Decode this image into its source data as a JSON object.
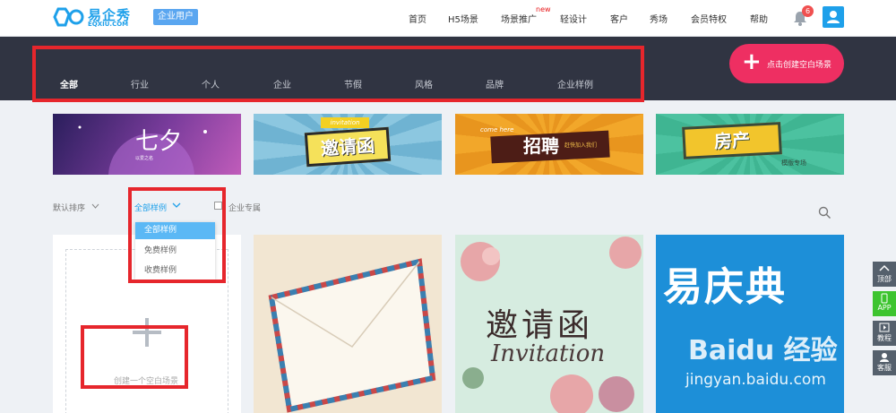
{
  "header": {
    "logo_text": "易企秀",
    "logo_sub": "EQXIU.COM",
    "user_tag": "企业用户",
    "nav": [
      "首页",
      "H5场景",
      "场景推广",
      "轻设计",
      "客户",
      "秀场",
      "会员特权",
      "帮助"
    ],
    "new_label": "new",
    "notification_count": "6"
  },
  "categories": [
    "全部",
    "行业",
    "个人",
    "企业",
    "节假",
    "风格",
    "品牌",
    "企业样例"
  ],
  "create_button": {
    "label": "点击创建空白场景",
    "icon": "+"
  },
  "banners": [
    {
      "title": "七夕",
      "sub": "以爱之名"
    },
    {
      "title": "邀请函",
      "sub": "invitation"
    },
    {
      "title": "招聘",
      "sub": "赶快加入我们",
      "tag": "come here"
    },
    {
      "title": "房产",
      "sub": "模版专场"
    }
  ],
  "filters": {
    "sort": "默认排序",
    "sample": "全部样例",
    "enterprise_only": "企业专属"
  },
  "dropdown": [
    "全部样例",
    "免费样例",
    "收费样例"
  ],
  "cards": {
    "blank_label": "创建一个空白场景",
    "invite_title": "邀请函",
    "invite_script": "Invitation",
    "yqd_title": "易庆典",
    "watermark_brand": "Baidu 经验",
    "watermark_url": "jingyan.baidu.com"
  },
  "side_tools": [
    "顶部",
    "APP",
    "教程",
    "客服"
  ],
  "colors": {
    "brand": "#1ea0ea",
    "dark_bar": "#303442",
    "create_pink": "#ee2f62",
    "annotation_red": "#e6262c",
    "dropdown_selected": "#5bb8f5",
    "app_green": "#3dc42f"
  }
}
